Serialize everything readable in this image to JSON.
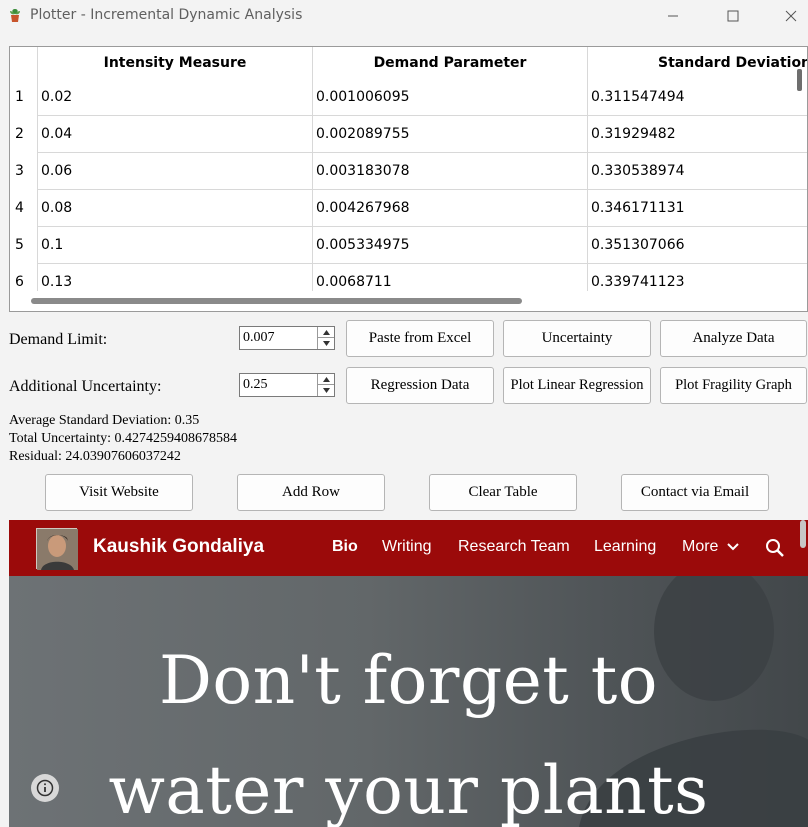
{
  "window": {
    "title": "Plotter - Incremental Dynamic Analysis",
    "icon": "plant-icon",
    "controls": [
      "minimize-icon",
      "maximize-icon",
      "close-icon"
    ]
  },
  "table": {
    "columns": [
      "Intensity Measure",
      "Demand Parameter",
      "Standard Deviation"
    ],
    "rows": [
      {
        "num": "1",
        "im": "0.02",
        "dp": "0.001006095",
        "sd": "0.311547494"
      },
      {
        "num": "2",
        "im": "0.04",
        "dp": "0.002089755",
        "sd": "0.31929482"
      },
      {
        "num": "3",
        "im": "0.06",
        "dp": "0.003183078",
        "sd": "0.330538974"
      },
      {
        "num": "4",
        "im": "0.08",
        "dp": "0.004267968",
        "sd": "0.346171131"
      },
      {
        "num": "5",
        "im": "0.1",
        "dp": "0.005334975",
        "sd": "0.351307066"
      },
      {
        "num": "6",
        "im": "0.13",
        "dp": "0.0068711",
        "sd": "0.339741123"
      }
    ]
  },
  "inputs": {
    "demand_limit_label": "Demand Limit:",
    "demand_limit_value": "0.007",
    "uncertainty_label": "Additional Uncertainty:",
    "uncertainty_value": "0.25"
  },
  "buttons": {
    "paste": "Paste from Excel",
    "uncertainty": "Uncertainty",
    "analyze": "Analyze Data",
    "regression_data": "Regression Data",
    "plot_linear": "Plot Linear Regression",
    "plot_fragility": "Plot Fragility Graph",
    "visit": "Visit Website",
    "add_row": "Add Row",
    "clear": "Clear Table",
    "contact": "Contact via Email"
  },
  "stats": {
    "avg_sd": "Average Standard Deviation: 0.35",
    "total_uncertainty": "Total Uncertainty: 0.4274259408678584",
    "residual": "Residual: 24.03907606037242"
  },
  "web": {
    "site_name": "Kaushik Gondaliya",
    "nav": [
      "Bio",
      "Writing",
      "Research Team",
      "Learning",
      "More"
    ],
    "hero_line1": "Don't forget to",
    "hero_line2": "water your plants",
    "colors": {
      "navbar": "#9b0a0a",
      "hero": "#5f6467"
    }
  }
}
